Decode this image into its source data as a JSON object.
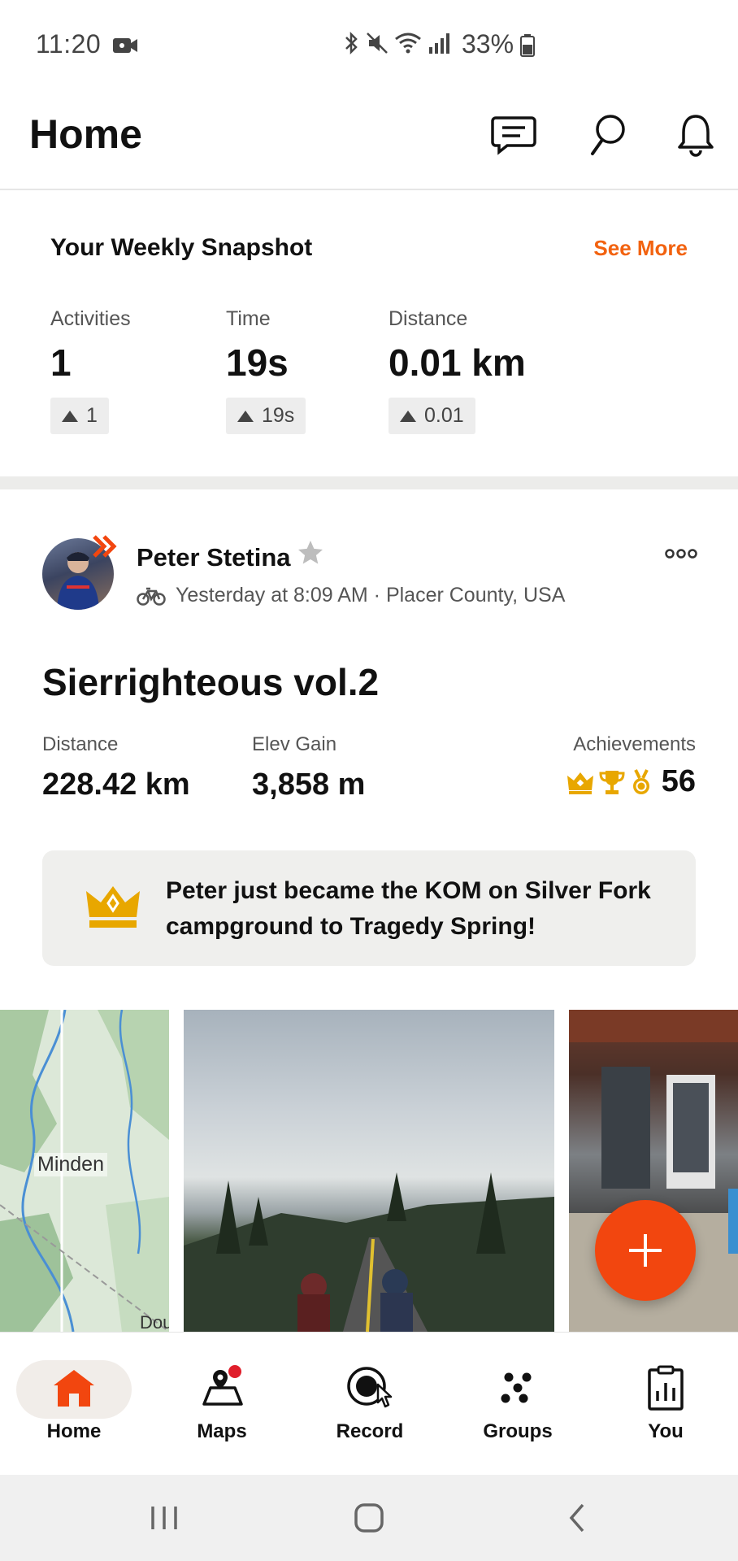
{
  "status_bar": {
    "time": "11:20",
    "battery": "33%"
  },
  "header": {
    "title": "Home",
    "icons": [
      "chat-icon",
      "search-icon",
      "bell-icon"
    ]
  },
  "snapshot": {
    "title": "Your Weekly Snapshot",
    "see_more": "See More",
    "stats": [
      {
        "label": "Activities",
        "value": "1",
        "delta": "1"
      },
      {
        "label": "Time",
        "value": "19s",
        "delta": "19s"
      },
      {
        "label": "Distance",
        "value": "0.01 km",
        "delta": "0.01"
      }
    ]
  },
  "activity": {
    "athlete": "Peter Stetina",
    "meta": "Yesterday at 8:09 AM · Placer County, USA",
    "title": "Sierrighteous vol.2",
    "stats": [
      {
        "label": "Distance",
        "value": "228.42 km"
      },
      {
        "label": "Elev Gain",
        "value": "3,858 m"
      }
    ],
    "achievements_label": "Achievements",
    "achievements_count": "56",
    "kom_text": "Peter just became the KOM on Silver Fork campground to Tragedy Spring!",
    "map_labels": [
      "Minden",
      "Dou"
    ]
  },
  "bottom_nav": [
    {
      "label": "Home",
      "icon": "home-icon",
      "active": true
    },
    {
      "label": "Maps",
      "icon": "maps-icon"
    },
    {
      "label": "Record",
      "icon": "record-icon"
    },
    {
      "label": "Groups",
      "icon": "groups-icon"
    },
    {
      "label": "You",
      "icon": "you-icon"
    }
  ],
  "colors": {
    "accent": "#f2620f",
    "fab": "#f2460f",
    "gold": "#e8a700"
  }
}
